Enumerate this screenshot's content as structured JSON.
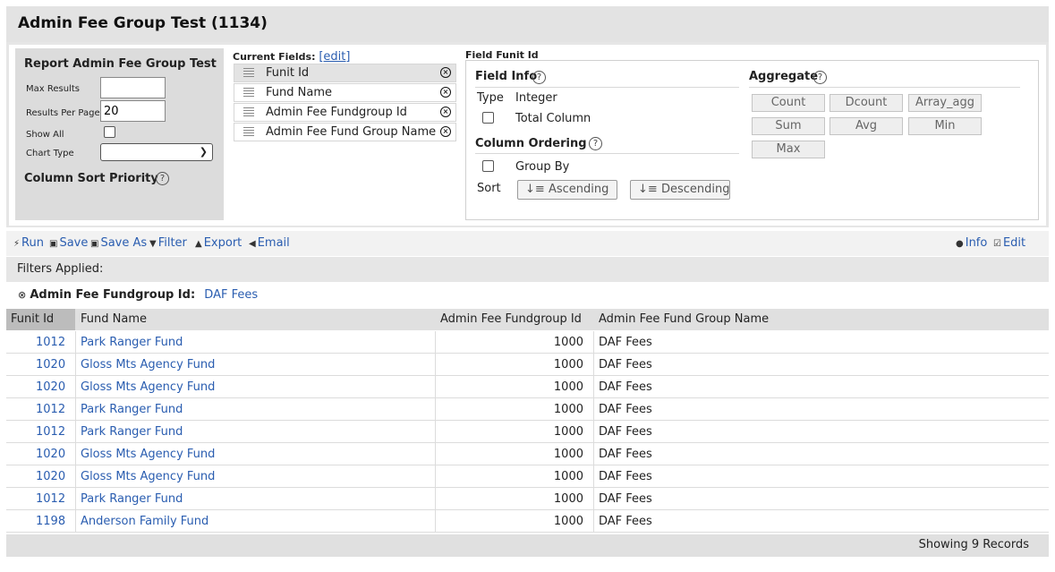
{
  "header": {
    "title": "Admin Fee Group Test (1134)"
  },
  "report": {
    "title": "Report Admin Fee Group Test",
    "max_results_label": "Max Results",
    "max_results_value": "",
    "results_per_page_label": "Results Per Page",
    "results_per_page_value": "20",
    "show_all_label": "Show All",
    "chart_type_label": "Chart Type",
    "chart_type_value": "",
    "sort_priority_label": "Column Sort Priority"
  },
  "current_fields": {
    "label": "Current Fields:",
    "edit_label": "[edit]",
    "items": [
      {
        "name": "Funit Id"
      },
      {
        "name": "Fund Name"
      },
      {
        "name": "Admin Fee Fundgroup Id"
      },
      {
        "name": "Admin Fee Fund Group Name"
      }
    ]
  },
  "field": {
    "title": "Field Funit Id",
    "info_label": "Field Info",
    "type_label": "Type",
    "type_value": "Integer",
    "total_column_label": "Total Column",
    "ordering_label": "Column Ordering",
    "group_by_label": "Group By",
    "sort_label": "Sort",
    "ascending_label": "Ascending",
    "descending_label": "Descending",
    "aggregate_label": "Aggregate",
    "aggregates": [
      "Count",
      "Dcount",
      "Array_agg",
      "Sum",
      "Avg",
      "Min",
      "Max"
    ]
  },
  "toolbar": {
    "run": "Run",
    "save": "Save",
    "save_as": "Save As",
    "filter": "Filter",
    "export": "Export",
    "email": "Email",
    "info": "Info",
    "edit": "Edit"
  },
  "filters": {
    "label": "Filters Applied:",
    "field": "Admin Fee Fundgroup Id:",
    "value": "DAF Fees"
  },
  "table": {
    "columns": [
      "Funit Id",
      "Fund Name",
      "Admin Fee Fundgroup Id",
      "Admin Fee Fund Group Name"
    ],
    "rows": [
      [
        "1012",
        "Park Ranger Fund",
        "1000",
        "DAF Fees"
      ],
      [
        "1020",
        "Gloss Mts Agency Fund",
        "1000",
        "DAF Fees"
      ],
      [
        "1020",
        "Gloss Mts Agency Fund",
        "1000",
        "DAF Fees"
      ],
      [
        "1012",
        "Park Ranger Fund",
        "1000",
        "DAF Fees"
      ],
      [
        "1012",
        "Park Ranger Fund",
        "1000",
        "DAF Fees"
      ],
      [
        "1020",
        "Gloss Mts Agency Fund",
        "1000",
        "DAF Fees"
      ],
      [
        "1020",
        "Gloss Mts Agency Fund",
        "1000",
        "DAF Fees"
      ],
      [
        "1012",
        "Park Ranger Fund",
        "1000",
        "DAF Fees"
      ],
      [
        "1198",
        "Anderson Family Fund",
        "1000",
        "DAF Fees"
      ]
    ],
    "footer": "Showing 9 Records"
  }
}
